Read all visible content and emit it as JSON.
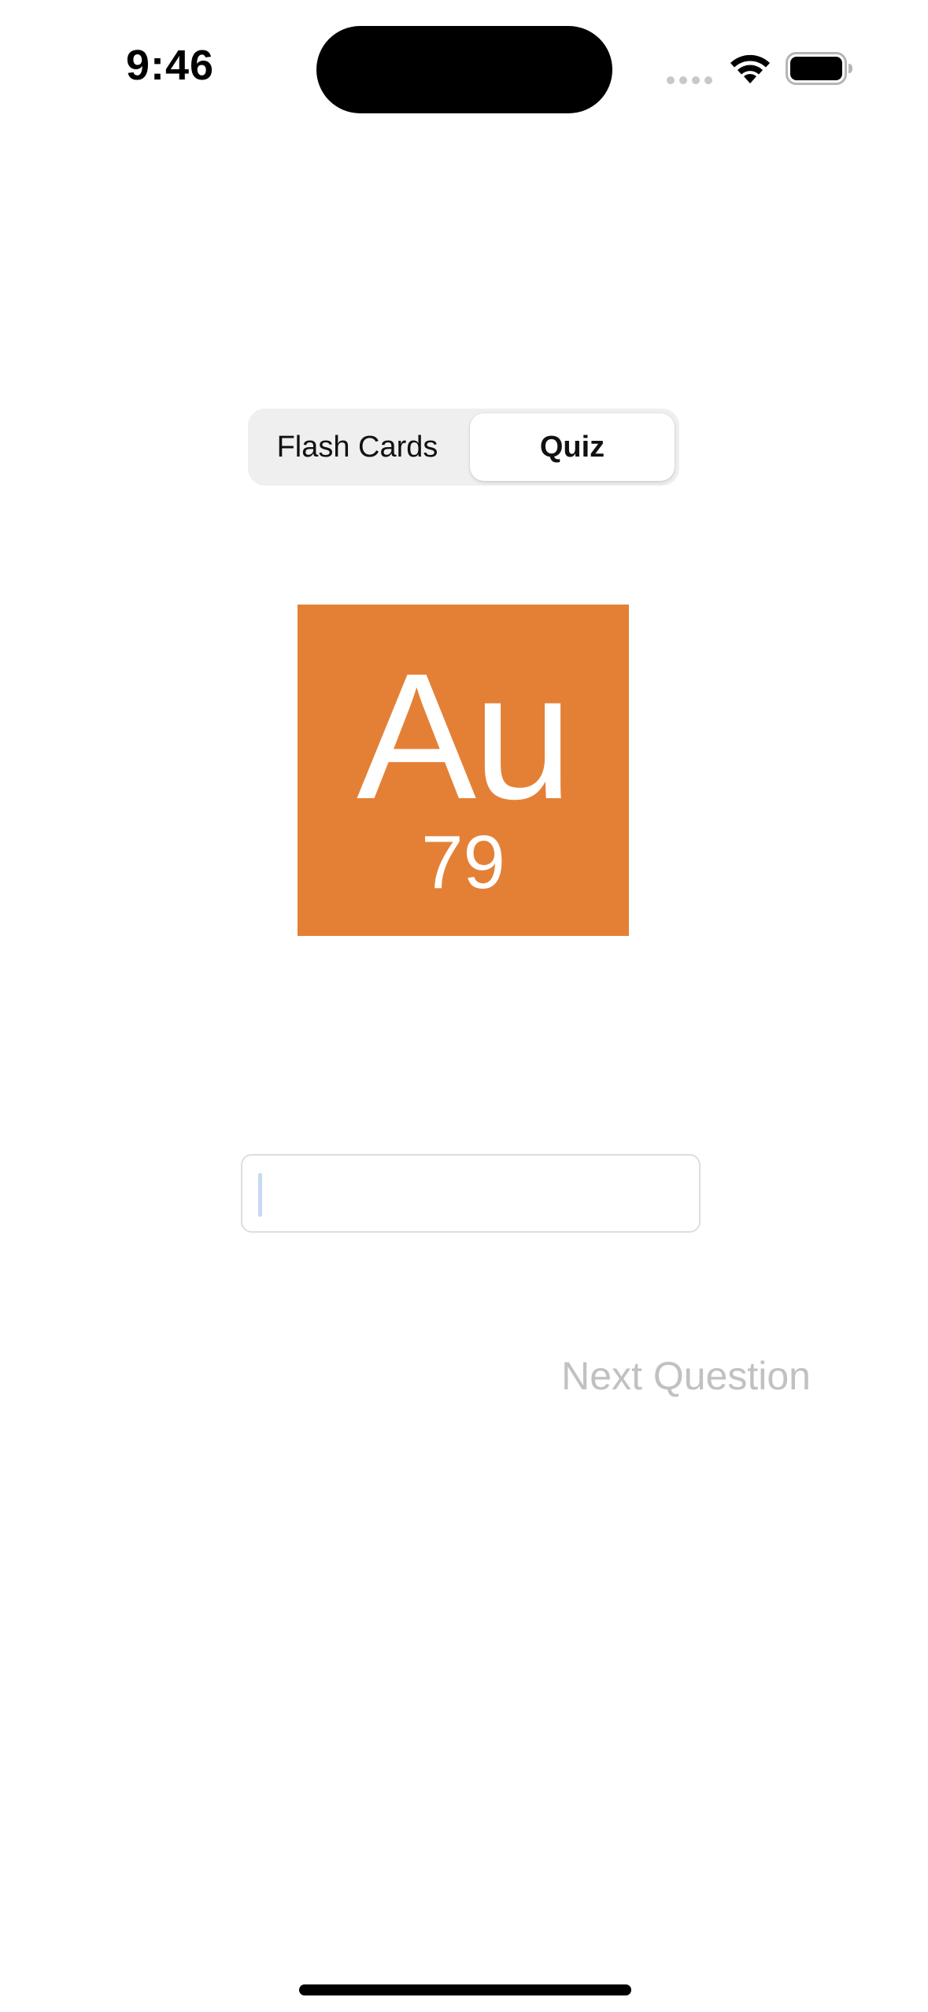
{
  "status_bar": {
    "time": "9:46",
    "icons": [
      "cellular-signal-icon",
      "wifi-icon",
      "battery-icon"
    ]
  },
  "mode_selector": {
    "segments": [
      {
        "label": "Flash Cards",
        "selected": false
      },
      {
        "label": "Quiz",
        "selected": true
      }
    ]
  },
  "element": {
    "symbol": "Au",
    "atomic_number": "79",
    "color": "#e48036"
  },
  "answer": {
    "value": "",
    "placeholder": ""
  },
  "actions": {
    "next_question_label": "Next Question",
    "next_question_enabled": false
  }
}
